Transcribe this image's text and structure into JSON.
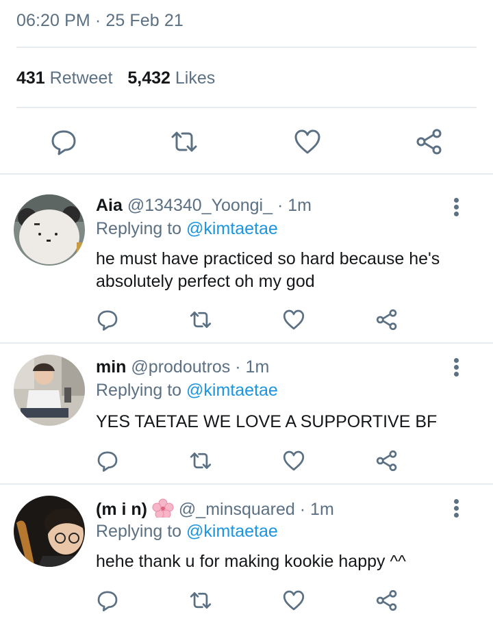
{
  "tweet": {
    "time": "06:20 PM",
    "separator": "·",
    "date": "25 Feb 21",
    "retweet_count": "431",
    "retweet_label": "Retweet",
    "likes_count": "5,432",
    "likes_label": "Likes",
    "actions": [
      "reply-icon",
      "retweet-icon",
      "like-icon",
      "share-icon"
    ]
  },
  "replies": [
    {
      "name": "Aia",
      "handle": "@134340_Yoongi_",
      "time": "· 1m",
      "replying_prefix": "Replying to",
      "replying_to": "@kimtaetae",
      "text": "he must have practiced so hard because he's absolutely perfect oh my god"
    },
    {
      "name": "min",
      "handle": "@prodoutros",
      "time": "· 1m",
      "replying_prefix": "Replying to",
      "replying_to": "@kimtaetae",
      "text": "YES TAETAE WE LOVE A SUPPORTIVE BF"
    },
    {
      "name": "(m i n)",
      "name_emoji": "cherry-blossom-icon",
      "handle": "@_minsquared",
      "time": "· 1m",
      "replying_prefix": "Replying to",
      "replying_to": "@kimtaetae",
      "text": "hehe thank u for making kookie happy ^^"
    }
  ],
  "colors": {
    "text": "#14171a",
    "secondary": "#5b7083",
    "link": "#1b95e0",
    "divider": "#e6ecf0"
  }
}
